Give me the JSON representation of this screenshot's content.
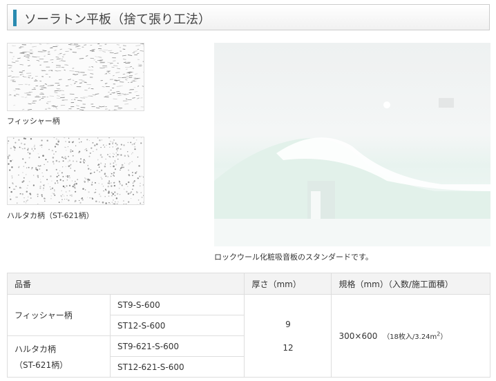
{
  "header": {
    "title": "ソーラトン平板（捨て張り工法）"
  },
  "patterns": [
    {
      "caption": "フィッシャー柄"
    },
    {
      "caption": "ハルタカ柄（ST-621柄）"
    }
  ],
  "photo": {
    "caption": "ロックウール化粧吸音板のスタンダードです。"
  },
  "table": {
    "headers": [
      "品番",
      "厚さ（mm）",
      "規格（mm）（入数/施工面積）"
    ],
    "groups": [
      {
        "name": "フィッシャー柄",
        "name_sub": "",
        "codes": [
          "ST9-S-600",
          "ST12-S-600"
        ]
      },
      {
        "name": "ハルタカ柄",
        "name_sub": "（ST-621柄）",
        "codes": [
          "ST9-621-S-600",
          "ST12-621-S-600"
        ]
      }
    ],
    "thickness": [
      "9",
      "12"
    ],
    "size": "300×600",
    "size_note": "（18枚入/3.24m",
    "size_note_sup": "2",
    "size_note_end": "）"
  },
  "colors": {
    "accent": "#2a8bb0"
  }
}
